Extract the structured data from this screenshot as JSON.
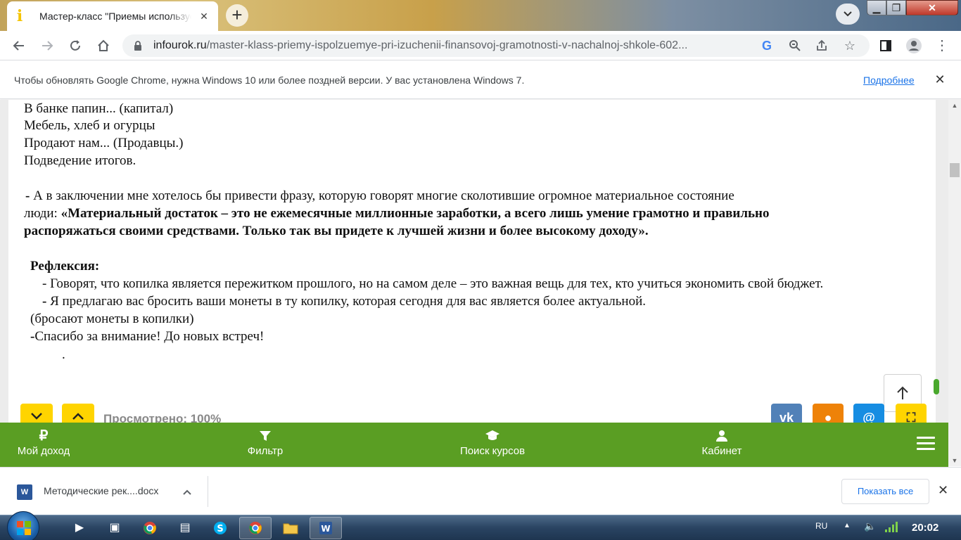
{
  "tab": {
    "title": "Мастер-класс \"Приемы используемые при изучении финансовой грамотности\"",
    "close": "✕"
  },
  "toolbar": {
    "url_host": "infourok.ru",
    "url_path": "/master-klass-priemy-ispolzuemye-pri-izuchenii-finansovoj-gramotnosti-v-nachalnoj-shkole-602..."
  },
  "infobar": {
    "message": "Чтобы обновлять Google Chrome, нужна Windows 10 или более поздней версии. У вас установлена Windows 7.",
    "link": "Подробнее"
  },
  "article": {
    "lines": [
      "В банке папин... (капитал)",
      "Мебель, хлеб и огурцы",
      "Продают нам... (Продавцы.)",
      "Подведение итогов."
    ],
    "quote_dash": " - ",
    "quote_intro": "А в заключении мне хотелось бы привести фразу, которую говорят многие сколотившие огромное материальное состояние",
    "quote_prefix": "люди: ",
    "quote_bold_1": "«Материальный достаток – это не ежемесячные миллионные заработки, а всего лишь умение грамотно и правильно",
    "quote_bold_2": "распоряжаться своими средствами. Только так вы придете к лучшей жизни и более высокому доходу».",
    "reflection_title": "Рефлексия:",
    "reflection_1": "- Говорят, что копилка является пережитком прошлого, но на самом деле – это важная вещь для тех, кто учиться экономить свой бюджет.",
    "reflection_2_dash": "- ",
    "reflection_2": "Я предлагаю вас бросить ваши монеты в ту копилку, которая сегодня для вас является более актуальной.",
    "reflection_3": "(бросают монеты в копилки)",
    "thanks_dash": "-",
    "thanks": "Спасибо за внимание! До новых встреч!",
    "dot": "."
  },
  "viewer": {
    "viewed": "Просмотрено: 100%"
  },
  "sitebar": {
    "income": "Мой доход",
    "filter": "Фильтр",
    "courses": "Поиск курсов",
    "cabinet": "Кабинет"
  },
  "downloads": {
    "file": "Методические рек....docx",
    "show_all": "Показать все"
  },
  "taskbar": {
    "lang": "RU",
    "time": "20:02"
  },
  "colors": {
    "site_green": "#5a9e23",
    "accent_yellow": "#ffd400",
    "link_blue": "#1a73e8"
  }
}
